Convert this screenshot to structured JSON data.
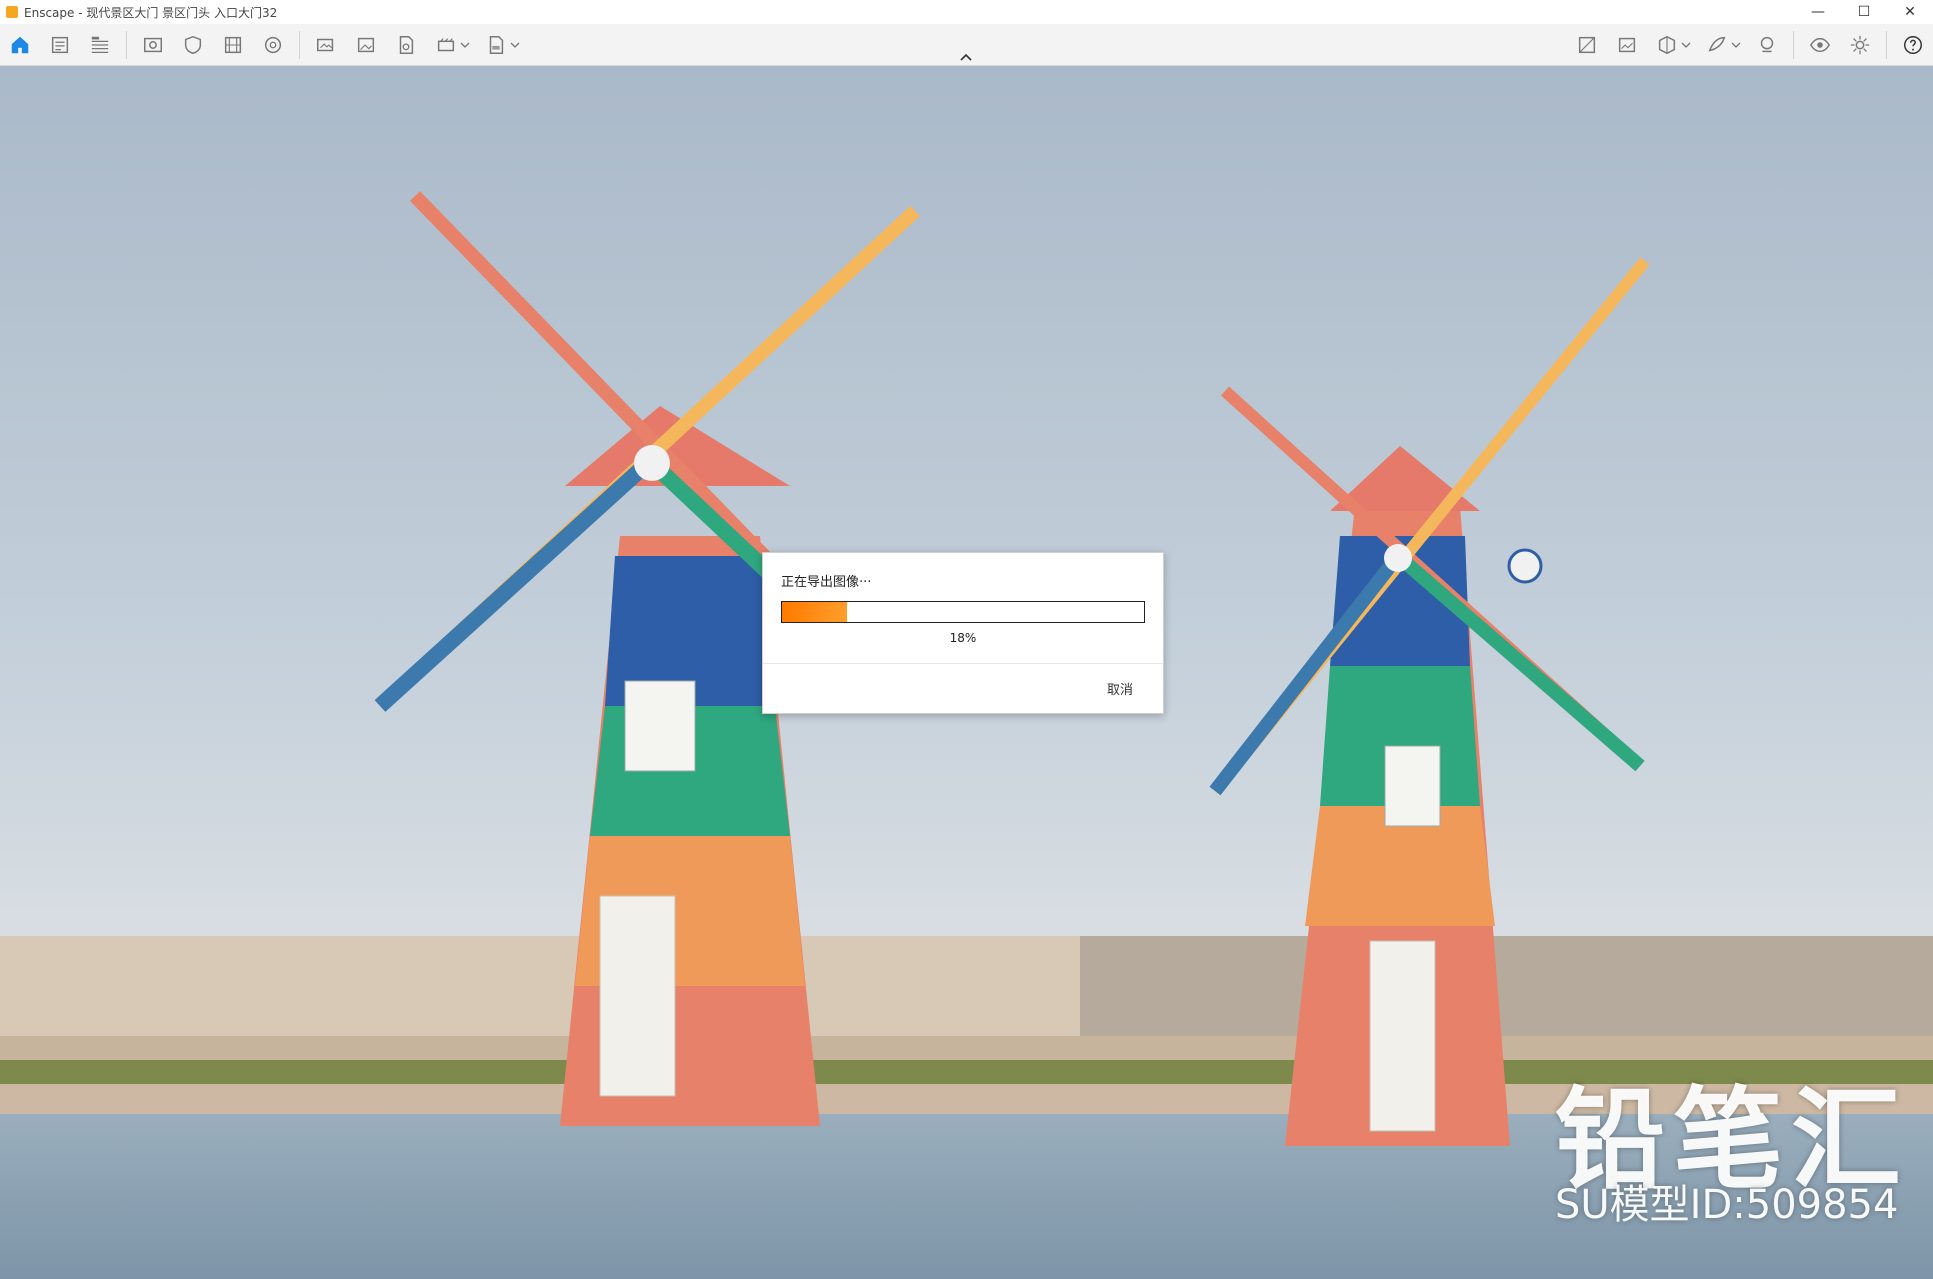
{
  "window": {
    "title": "Enscape - 现代景区大门 景区门头 入口大门32",
    "minimize": "—",
    "maximize": "☐",
    "close": "✕"
  },
  "toolbar": {
    "left_icons": [
      "home-icon",
      "views-icon",
      "bim-icon",
      "capture-icon",
      "safe-frame-icon",
      "batch-icon",
      "vr-icon",
      "screenshot-icon",
      "image-icon",
      "panorama-icon",
      "video-icon",
      "exe-export-icon"
    ],
    "right_icons": [
      "asset-library-icon",
      "material-editor-icon",
      "section-icon",
      "visual-settings-icon",
      "collaboration-icon",
      "view-toggle-icon",
      "settings-icon",
      "help-icon"
    ]
  },
  "dialog": {
    "message": "正在导出图像···",
    "progress": 0.18,
    "percent_label": "18%",
    "cancel_label": "取消",
    "progress_color": "#ff7a00"
  },
  "watermark": {
    "brand": "铅笔汇",
    "model_id": "SU模型ID:509854"
  }
}
